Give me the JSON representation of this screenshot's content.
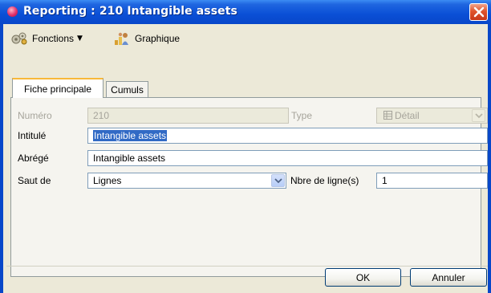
{
  "window": {
    "title": "Reporting : 210 Intangible assets"
  },
  "toolbar": {
    "fonctions_label": "Fonctions",
    "fonctions_icon": "gears-icon",
    "graphique_label": "Graphique",
    "graphique_icon": "chart-people-icon"
  },
  "tabs": [
    {
      "label": "Fiche principale",
      "active": true
    },
    {
      "label": "Cumuls",
      "active": false
    }
  ],
  "form": {
    "numero_label": "Numéro",
    "numero_value": "210",
    "type_label": "Type",
    "type_value": "Détail",
    "intitule_label": "Intitulé",
    "intitule_value": "Intangible assets",
    "abrege_label": "Abrégé",
    "abrege_value": "Intangible assets",
    "saut_label": "Saut de",
    "saut_value": "Lignes",
    "nbre_label": "Nbre de ligne(s)",
    "nbre_value": "1"
  },
  "buttons": {
    "ok": "OK",
    "cancel": "Annuler"
  },
  "colors": {
    "titlebar": "#0a4fd6",
    "selection": "#316ac5",
    "active_tab_accent": "#f8b83a"
  }
}
